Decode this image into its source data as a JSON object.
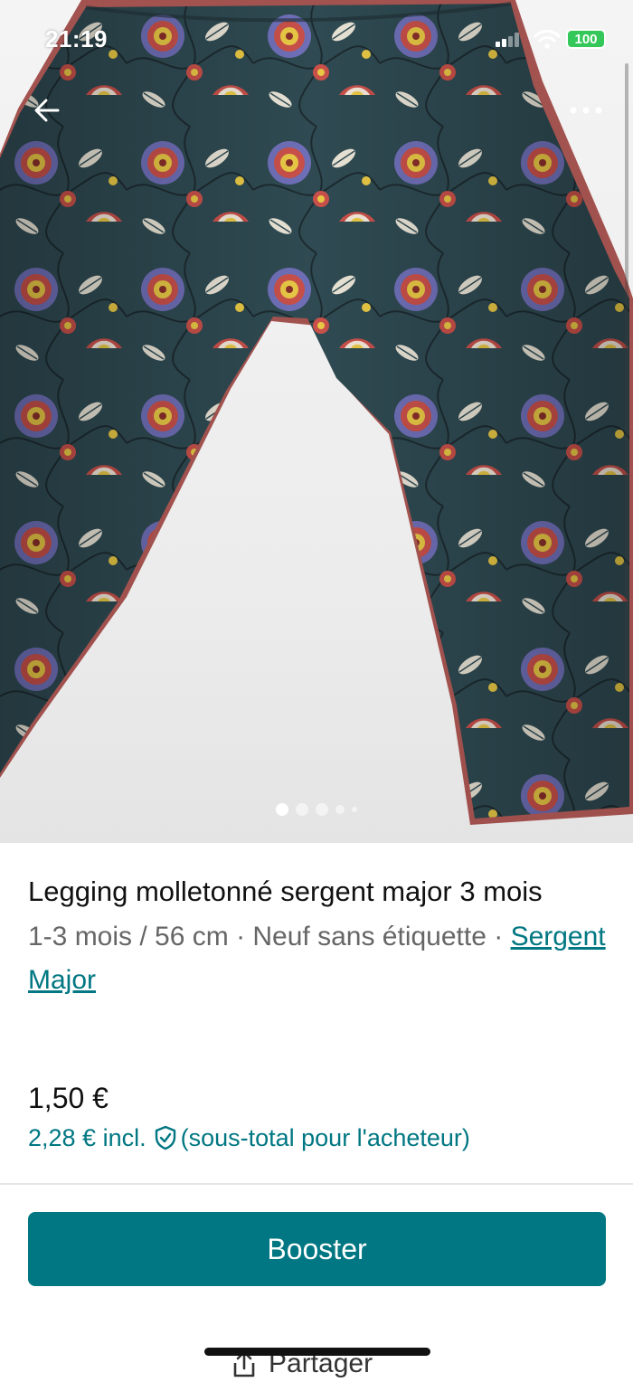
{
  "status_bar": {
    "time": "21:19",
    "battery": "100",
    "icons": [
      "signal-icon",
      "wifi-icon"
    ]
  },
  "photo": {
    "alt": "Legging molletonné à motif floral",
    "carousel_pages": 5,
    "active_page": 1
  },
  "nav": {
    "back_icon": "arrow-left-icon",
    "more_icon": "ellipsis-icon"
  },
  "product": {
    "title": "Legging molletonné sergent major 3 mois",
    "meta": "1-3 mois / 56 cm · Neuf sans étiquette · ",
    "brand": "Sergent Major",
    "price": "1,50 €",
    "price_incl": "2,28 € incl.",
    "price_incl_note": "(sous-total pour l'acheteur)"
  },
  "actions": {
    "booster_label": "Booster",
    "share_label": "Partager"
  },
  "colors": {
    "accent": "#007782",
    "fabric": "#2f4a52",
    "flower_red": "#c9504a",
    "flower_blue": "#6f6fb8",
    "flower_yellow": "#e8c845"
  }
}
